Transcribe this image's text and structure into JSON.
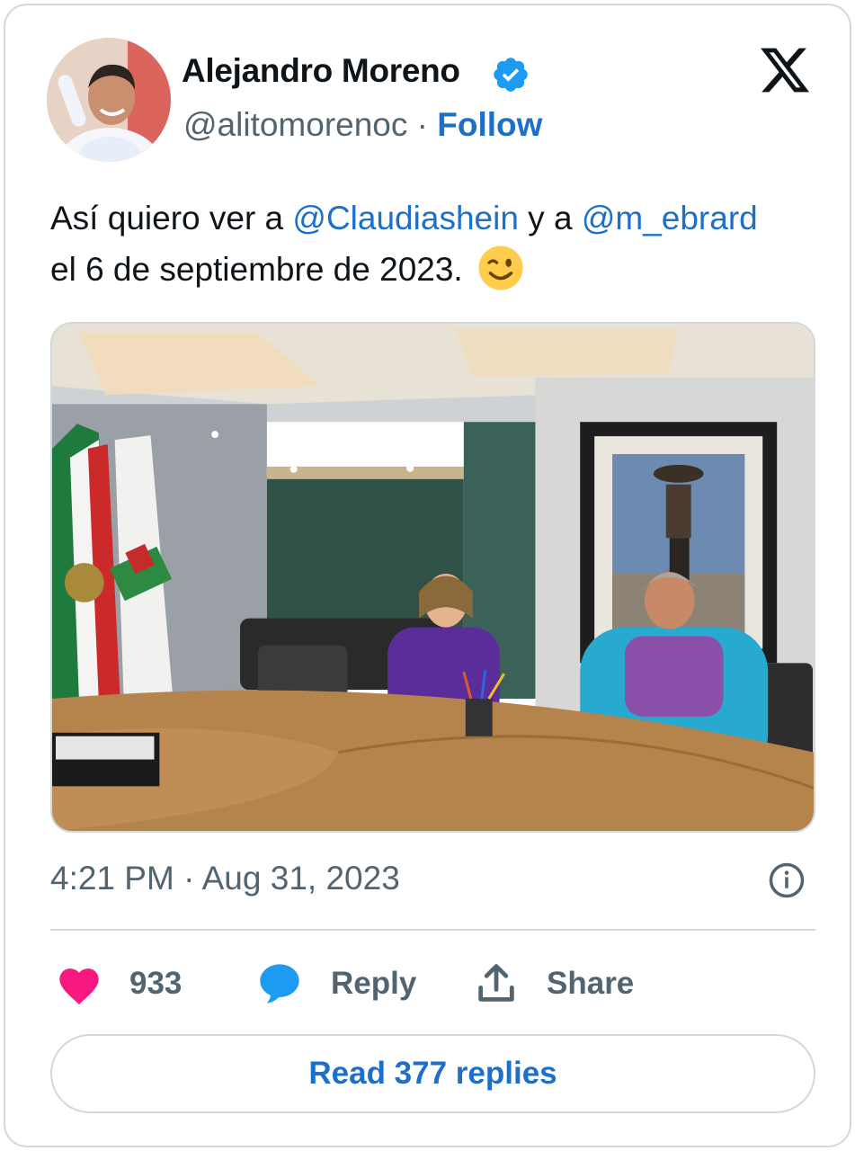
{
  "author": {
    "name": "Alejandro Moreno",
    "handle": "@alitomorenoc",
    "separator": "·",
    "follow_label": "Follow",
    "verified": true
  },
  "brand": {
    "logo_icon": "x-logo-icon"
  },
  "tweet": {
    "segments": [
      {
        "text": "Así quiero ver a ",
        "type": "text"
      },
      {
        "text": "@Claudiashein",
        "type": "mention"
      },
      {
        "text": " y a ",
        "type": "text"
      },
      {
        "text": "@m_ebrard",
        "type": "mention"
      },
      {
        "text": "el 6 de septiembre de 2023.",
        "type": "text"
      }
    ],
    "emoji": "winking-face-emoji"
  },
  "timestamp": "4:21 PM · Aug 31, 2023",
  "actions": {
    "like_count": "933",
    "reply_label": "Reply",
    "share_label": "Share"
  },
  "read_replies_label": "Read 377 replies",
  "colors": {
    "link": "#1d6fc8",
    "muted": "#536471",
    "border": "#cfd9de",
    "heart": "#f91880",
    "verified": "#1d9bf0"
  }
}
